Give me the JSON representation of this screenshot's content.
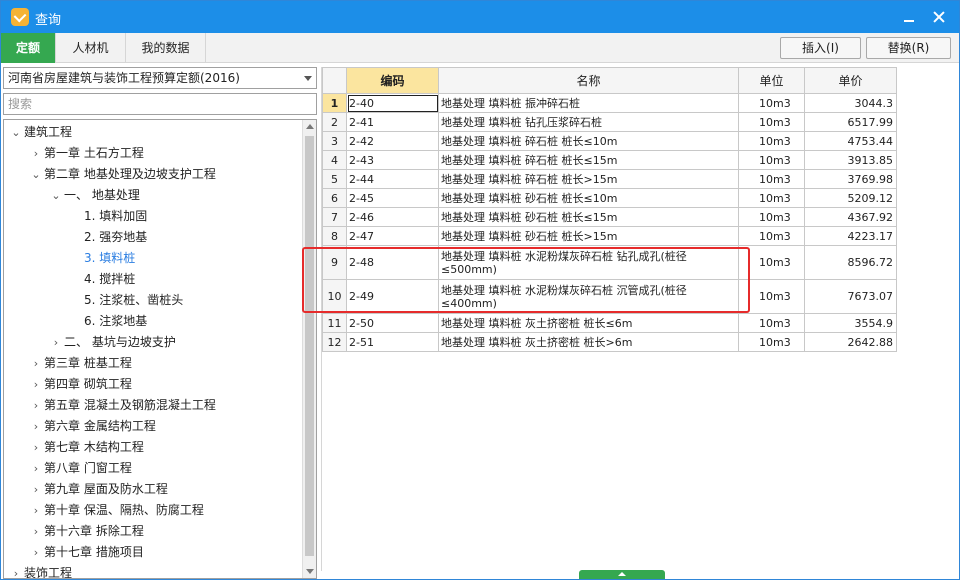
{
  "window": {
    "title": "查询"
  },
  "tabs": [
    {
      "label": "定额"
    },
    {
      "label": "人材机"
    },
    {
      "label": "我的数据"
    }
  ],
  "toolbar": {
    "insert_label": "插入(I)",
    "replace_label": "替换(R)"
  },
  "library": {
    "selected": "河南省房屋建筑与装饰工程预算定额(2016)"
  },
  "search": {
    "placeholder": "搜索"
  },
  "tree": [
    {
      "label": "建筑工程",
      "chevron": "⌄",
      "indent": 0
    },
    {
      "label": "第一章  土石方工程",
      "chevron": "›",
      "indent": 1
    },
    {
      "label": "第二章  地基处理及边坡支护工程",
      "chevron": "⌄",
      "indent": 1
    },
    {
      "label": "一、  地基处理",
      "chevron": "⌄",
      "indent": 2
    },
    {
      "label": "1.  填料加固",
      "chevron": "",
      "indent": 3
    },
    {
      "label": "2.  强夯地基",
      "chevron": "",
      "indent": 3
    },
    {
      "label": "3.  填料桩",
      "chevron": "",
      "indent": 3,
      "selected": true
    },
    {
      "label": "4.  搅拌桩",
      "chevron": "",
      "indent": 3
    },
    {
      "label": "5.  注浆桩、凿桩头",
      "chevron": "",
      "indent": 3
    },
    {
      "label": "6.  注浆地基",
      "chevron": "",
      "indent": 3
    },
    {
      "label": "二、  基坑与边坡支护",
      "chevron": "›",
      "indent": 2
    },
    {
      "label": "第三章  桩基工程",
      "chevron": "›",
      "indent": 1
    },
    {
      "label": "第四章  砌筑工程",
      "chevron": "›",
      "indent": 1
    },
    {
      "label": "第五章  混凝土及钢筋混凝土工程",
      "chevron": "›",
      "indent": 1
    },
    {
      "label": "第六章  金属结构工程",
      "chevron": "›",
      "indent": 1
    },
    {
      "label": "第七章  木结构工程",
      "chevron": "›",
      "indent": 1
    },
    {
      "label": "第八章  门窗工程",
      "chevron": "›",
      "indent": 1
    },
    {
      "label": "第九章  屋面及防水工程",
      "chevron": "›",
      "indent": 1
    },
    {
      "label": "第十章  保温、隔热、防腐工程",
      "chevron": "›",
      "indent": 1
    },
    {
      "label": "第十六章  拆除工程",
      "chevron": "›",
      "indent": 1
    },
    {
      "label": "第十七章  措施项目",
      "chevron": "›",
      "indent": 1
    },
    {
      "label": "装饰工程",
      "chevron": "›",
      "indent": 0
    }
  ],
  "grid": {
    "headers": {
      "code": "编码",
      "name": "名称",
      "unit": "单位",
      "price": "单价"
    },
    "rows": [
      {
        "no": "1",
        "code": "2-40",
        "name": "地基处理 填料桩 振冲碎石桩",
        "unit": "10m3",
        "price": "3044.3"
      },
      {
        "no": "2",
        "code": "2-41",
        "name": "地基处理 填料桩 钻孔压浆碎石桩",
        "unit": "10m3",
        "price": "6517.99"
      },
      {
        "no": "3",
        "code": "2-42",
        "name": "地基处理 填料桩 碎石桩 桩长≤10m",
        "unit": "10m3",
        "price": "4753.44"
      },
      {
        "no": "4",
        "code": "2-43",
        "name": "地基处理 填料桩 碎石桩 桩长≤15m",
        "unit": "10m3",
        "price": "3913.85"
      },
      {
        "no": "5",
        "code": "2-44",
        "name": "地基处理 填料桩 碎石桩 桩长>15m",
        "unit": "10m3",
        "price": "3769.98"
      },
      {
        "no": "6",
        "code": "2-45",
        "name": "地基处理 填料桩 砂石桩 桩长≤10m",
        "unit": "10m3",
        "price": "5209.12"
      },
      {
        "no": "7",
        "code": "2-46",
        "name": "地基处理 填料桩 砂石桩 桩长≤15m",
        "unit": "10m3",
        "price": "4367.92"
      },
      {
        "no": "8",
        "code": "2-47",
        "name": "地基处理 填料桩 砂石桩 桩长>15m",
        "unit": "10m3",
        "price": "4223.17"
      },
      {
        "no": "9",
        "code": "2-48",
        "name": "地基处理 填料桩 水泥粉煤灰碎石桩 钻孔成孔(桩径≤500mm)",
        "unit": "10m3",
        "price": "8596.72",
        "tall": true
      },
      {
        "no": "10",
        "code": "2-49",
        "name": "地基处理 填料桩 水泥粉煤灰碎石桩 沉管成孔(桩径≤400mm)",
        "unit": "10m3",
        "price": "7673.07",
        "tall": true
      },
      {
        "no": "11",
        "code": "2-50",
        "name": "地基处理 填料桩 灰土挤密桩 桩长≤6m",
        "unit": "10m3",
        "price": "3554.9"
      },
      {
        "no": "12",
        "code": "2-51",
        "name": "地基处理 填料桩 灰土挤密桩 桩长>6m",
        "unit": "10m3",
        "price": "2642.88"
      }
    ]
  }
}
